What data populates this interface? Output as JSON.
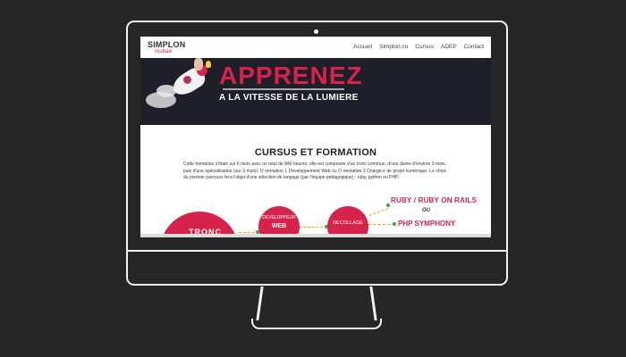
{
  "header": {
    "logo_main": "SIMPLON",
    "logo_sub": "roubaix",
    "nav": [
      "Accueil",
      "Simplon.co",
      "Cursus",
      "ADEP",
      "Contact"
    ]
  },
  "hero": {
    "headline": "APPRENEZ",
    "subline": "A LA VITESSE DE LA LUMIERE"
  },
  "section": {
    "title": "CURSUS ET FORMATION",
    "text": "Cette formation s'étale sur 6 mois avec un total de 840 heures, elle est composée d'un tronc commun, d'une durée d'environ 3 mois, puis d'une spécialisation (sur 3 mois): O rientation 1   Développement Web ou O rientation 2   Chargé.e de projet numérique. Le choix du premier parcours fera l'objet d'une sélection de langage (par l'équipe pédagogique) : ruby, python ou PHP."
  },
  "diagram": {
    "big_circle": "TRONC",
    "mid_line1": "DEVELOPPEUR",
    "mid_line2": "WEB",
    "right_circle": "DECOLLAGE",
    "option1": "RUBY / RUBY ON RAILS",
    "or": "OU",
    "option2": "PHP SYMPHONY"
  },
  "colors": {
    "brand_red": "#d6234c",
    "hero_bg": "#1f1f2a",
    "frame": "#f2f2f2",
    "background": "#262626"
  }
}
